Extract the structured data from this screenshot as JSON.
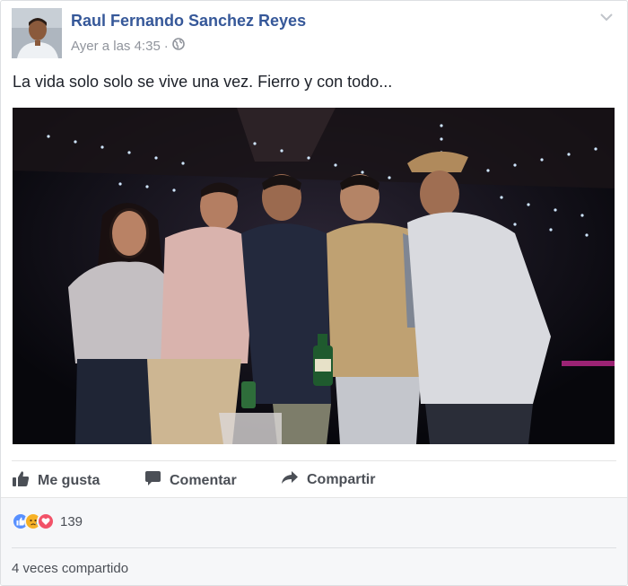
{
  "post": {
    "author": "Raul Fernando Sanchez Reyes",
    "timestamp": "Ayer a las 4:35",
    "separator": "·",
    "privacy_icon": "globe-icon",
    "options_icon": "chevron-down-icon",
    "text": "La vida solo solo se vive una vez. Fierro y con todo..."
  },
  "actions": {
    "like_label": "Me gusta",
    "comment_label": "Comentar",
    "share_label": "Compartir"
  },
  "feedback": {
    "reaction_icons": [
      "like-reaction-icon",
      "sad-reaction-icon",
      "love-reaction-icon"
    ],
    "reaction_count": "139",
    "shares_text": "4 veces compartido"
  },
  "colors": {
    "name_link": "#365899",
    "like_blue": "#5890ff",
    "love_red": "#f25268",
    "sad_yellow": "#f7b125",
    "muted_text": "#90949c"
  }
}
